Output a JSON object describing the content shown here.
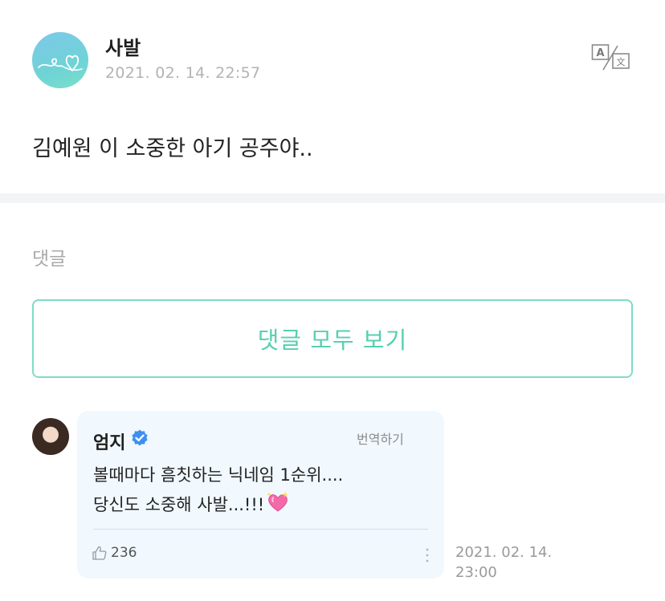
{
  "post": {
    "author": "사발",
    "timestamp": "2021. 02. 14. 22:57",
    "body": "김예원 이 소중한 아기 공주야..",
    "translate_icon": "translate-icon"
  },
  "comments_section": {
    "label": "댓글",
    "view_all_label": "댓글 모두 보기"
  },
  "comment": {
    "author": "엄지",
    "verified_icon": "verified-badge-icon",
    "translate_label": "번역하기",
    "line1": "볼때마다 흠칫하는 닉네임 1순위....",
    "line2": "당신도 소중해 사발...!!!",
    "emoji": "sparkling-heart-icon",
    "likes": "236",
    "time_line1": "2021. 02. 14.",
    "time_line2": "23:00"
  },
  "colors": {
    "accent": "#56d0b0",
    "card_bg": "#f1f8fe",
    "verified": "#3f8ff0"
  }
}
